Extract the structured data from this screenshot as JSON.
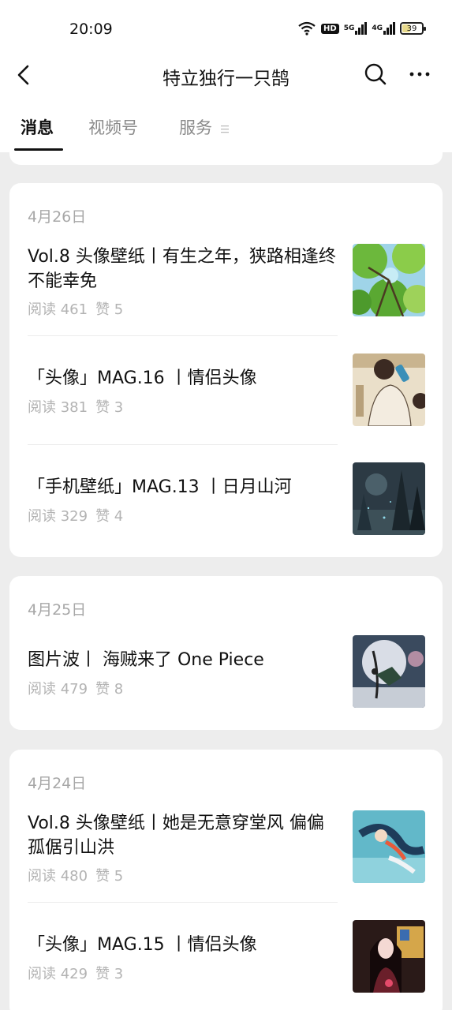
{
  "status": {
    "time": "20:09",
    "hd": "HD",
    "net1": "5G",
    "net2": "4G",
    "battery": "39",
    "icons": [
      "wifi-icon",
      "hd-icon",
      "signal-5g-icon",
      "signal-4g-icon",
      "battery-icon"
    ]
  },
  "nav": {
    "title": "特立独行一只鹄",
    "back_icon": "chevron-left-icon",
    "search_icon": "search-icon",
    "more_icon": "more-dots-icon"
  },
  "tabs": [
    {
      "label": "消息",
      "active": true
    },
    {
      "label": "视频号",
      "active": false
    },
    {
      "label": "服务",
      "active": false
    }
  ],
  "groups": [
    {
      "date": "4月26日",
      "items": [
        {
          "title": "Vol.8 头像壁纸丨有生之年，狭路相逢终不能幸免",
          "reads": "阅读 461",
          "likes": "赞 5"
        },
        {
          "title": "「头像」MAG.16 丨情侣头像",
          "reads": "阅读 381",
          "likes": "赞 3"
        },
        {
          "title": "「手机壁纸」MAG.13 丨日月山河",
          "reads": "阅读 329",
          "likes": "赞 4"
        }
      ]
    },
    {
      "date": "4月25日",
      "items": [
        {
          "title": "图片波丨 海贼来了 One Piece",
          "reads": "阅读 479",
          "likes": "赞 8"
        }
      ]
    },
    {
      "date": "4月24日",
      "items": [
        {
          "title": "Vol.8 头像壁纸丨她是无意穿堂风 偏偏孤倨引山洪",
          "reads": "阅读 480",
          "likes": "赞 5"
        },
        {
          "title": "「头像」MAG.15 丨情侣头像",
          "reads": "阅读 429",
          "likes": "赞 3"
        }
      ]
    }
  ],
  "colors": {
    "background": "#ededed",
    "card": "#ffffff",
    "text": "#111111",
    "meta": "#b3b3b3",
    "date": "#a7a7a7"
  }
}
